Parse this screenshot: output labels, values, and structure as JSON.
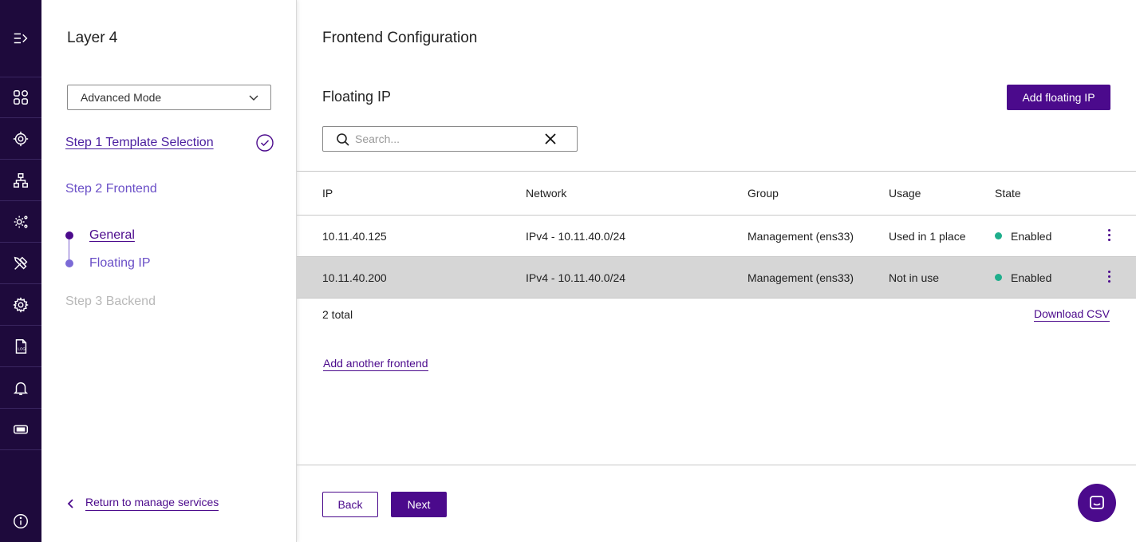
{
  "rail": {
    "icons": [
      "expand-menu-icon",
      "dashboard-icon",
      "services-icon",
      "network-icon",
      "system-settings-icon",
      "tools-icon",
      "settings-icon",
      "logs-icon",
      "notifications-icon",
      "license-icon",
      "info-icon"
    ]
  },
  "steps": {
    "title": "Layer 4",
    "mode": "Advanced Mode",
    "step1": "Step 1 Template Selection",
    "step2": "Step 2 Frontend",
    "sub_general": "General",
    "sub_floating": "Floating IP",
    "step3": "Step 3 Backend",
    "return": "Return to manage services"
  },
  "main": {
    "page_title": "Frontend Configuration",
    "section_title": "Floating IP",
    "add_button": "Add floating IP",
    "search_placeholder": "Search...",
    "columns": {
      "ip": "IP",
      "network": "Network",
      "group": "Group",
      "usage": "Usage",
      "state": "State"
    },
    "rows": [
      {
        "ip": "10.11.40.125",
        "network": "IPv4 - 10.11.40.0/24",
        "group": "Management (ens33)",
        "usage": "Used in 1 place",
        "state": "Enabled"
      },
      {
        "ip": "10.11.40.200",
        "network": "IPv4 - 10.11.40.0/24",
        "group": "Management (ens33)",
        "usage": "Not in use",
        "state": "Enabled"
      }
    ],
    "total": "2 total",
    "download": "Download CSV",
    "add_frontend": "Add another frontend",
    "back": "Back",
    "next": "Next"
  },
  "colors": {
    "brand": "#4b0a8c",
    "rail": "#1e0a3c",
    "enabled": "#1fae8c"
  }
}
